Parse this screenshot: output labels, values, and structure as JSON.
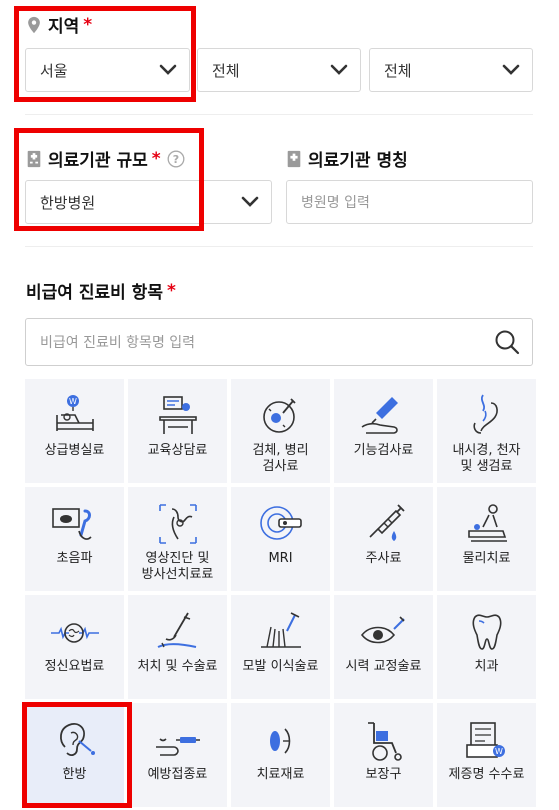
{
  "region": {
    "label": "지역",
    "required_mark": "*",
    "selects": [
      {
        "value": "서울"
      },
      {
        "value": "전체"
      },
      {
        "value": "전체"
      }
    ]
  },
  "institution": {
    "size_label": "의료기관 규모",
    "required_mark": "*",
    "size_value": "한방병원",
    "name_label": "의료기관 명칭",
    "name_placeholder": "병원명 입력"
  },
  "items": {
    "label": "비급여 진료비 항목",
    "required_mark": "*",
    "search_placeholder": "비급여 진료비 항목명 입력",
    "tiles": [
      {
        "label": "상급병실료",
        "icon": "hospital-bed-icon"
      },
      {
        "label": "교육상담료",
        "icon": "consultation-desk-icon"
      },
      {
        "label": "검체, 병리\n검사료",
        "icon": "specimen-pathology-icon"
      },
      {
        "label": "기능검사료",
        "icon": "function-test-icon"
      },
      {
        "label": "내시경, 천자\n및 생검료",
        "icon": "endoscopy-icon"
      },
      {
        "label": "초음파",
        "icon": "ultrasound-icon"
      },
      {
        "label": "영상진단 및\n방사선치료료",
        "icon": "radiology-icon"
      },
      {
        "label": "MRI",
        "icon": "mri-icon"
      },
      {
        "label": "주사료",
        "icon": "syringe-icon"
      },
      {
        "label": "물리치료",
        "icon": "physical-therapy-icon"
      },
      {
        "label": "정신요법료",
        "icon": "brain-wave-icon"
      },
      {
        "label": "처치 및 수술료",
        "icon": "surgery-icon"
      },
      {
        "label": "모발 이식술료",
        "icon": "hair-transplant-icon"
      },
      {
        "label": "시력 교정술료",
        "icon": "eye-laser-icon"
      },
      {
        "label": "치과",
        "icon": "tooth-icon"
      },
      {
        "label": "한방",
        "icon": "ear-acupuncture-icon",
        "selected": true
      },
      {
        "label": "예방접종료",
        "icon": "vaccination-icon"
      },
      {
        "label": "치료재료",
        "icon": "treatment-material-icon"
      },
      {
        "label": "보장구",
        "icon": "wheelchair-icon"
      },
      {
        "label": "제증명 수수료",
        "icon": "certificate-fee-icon"
      }
    ]
  },
  "colors": {
    "accent": "#3d6fe0",
    "required": "#e60012",
    "highlight_box": "#ee0000",
    "tile_bg": "#f3f4f8"
  }
}
